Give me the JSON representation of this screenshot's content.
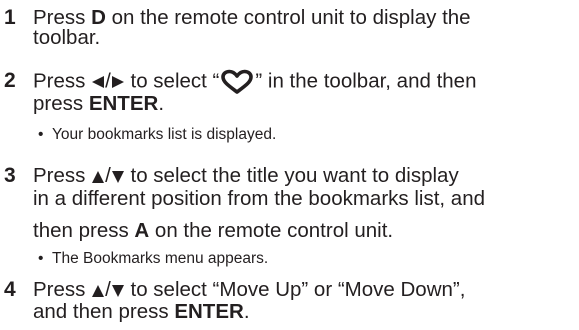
{
  "steps": [
    {
      "number": "1",
      "line1": {
        "pre": "Press ",
        "key": "D",
        "post": " on the remote control unit to display the"
      },
      "line2": "toolbar."
    },
    {
      "number": "2",
      "line1": {
        "pre": "Press ",
        "sep": "/",
        "mid": " to select “",
        "post": "” in the toolbar, and then"
      },
      "line2": {
        "pre": "press ",
        "key": "ENTER",
        "post": "."
      },
      "bullet": "Your bookmarks list is displayed."
    },
    {
      "number": "3",
      "line1": {
        "pre": "Press ",
        "sep": "/",
        "post": " to select the title you want to display"
      },
      "line2": "in a different position from the bookmarks list, and",
      "line3": {
        "pre": "then press ",
        "key": "A",
        "post": " on the remote control unit."
      },
      "bullet": "The Bookmarks menu appears."
    },
    {
      "number": "4",
      "line1": {
        "pre": "Press ",
        "sep": "/",
        "post": " to select “Move Up” or “Move Down”,"
      },
      "line2": {
        "pre": "and then press ",
        "key": "ENTER",
        "post": "."
      }
    }
  ],
  "icons": {
    "left_arrow": "left-triangle-icon",
    "right_arrow": "right-triangle-icon",
    "up_arrow": "up-triangle-icon",
    "down_arrow": "down-triangle-icon",
    "heart": "heart-outline-icon"
  },
  "colors": {
    "text": "#231f20",
    "heart": "#231f20"
  }
}
